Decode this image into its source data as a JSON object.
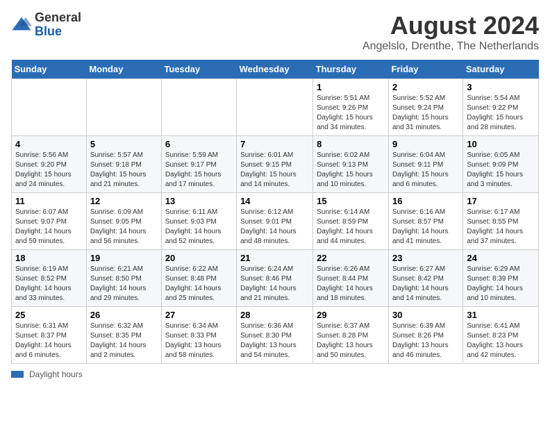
{
  "logo": {
    "general": "General",
    "blue": "Blue"
  },
  "header": {
    "month": "August 2024",
    "location": "Angelslo, Drenthe, The Netherlands"
  },
  "days_of_week": [
    "Sunday",
    "Monday",
    "Tuesday",
    "Wednesday",
    "Thursday",
    "Friday",
    "Saturday"
  ],
  "weeks": [
    [
      {
        "day": "",
        "info": ""
      },
      {
        "day": "",
        "info": ""
      },
      {
        "day": "",
        "info": ""
      },
      {
        "day": "",
        "info": ""
      },
      {
        "day": "1",
        "info": "Sunrise: 5:51 AM\nSunset: 9:26 PM\nDaylight: 15 hours and 34 minutes."
      },
      {
        "day": "2",
        "info": "Sunrise: 5:52 AM\nSunset: 9:24 PM\nDaylight: 15 hours and 31 minutes."
      },
      {
        "day": "3",
        "info": "Sunrise: 5:54 AM\nSunset: 9:22 PM\nDaylight: 15 hours and 28 minutes."
      }
    ],
    [
      {
        "day": "4",
        "info": "Sunrise: 5:56 AM\nSunset: 9:20 PM\nDaylight: 15 hours and 24 minutes."
      },
      {
        "day": "5",
        "info": "Sunrise: 5:57 AM\nSunset: 9:18 PM\nDaylight: 15 hours and 21 minutes."
      },
      {
        "day": "6",
        "info": "Sunrise: 5:59 AM\nSunset: 9:17 PM\nDaylight: 15 hours and 17 minutes."
      },
      {
        "day": "7",
        "info": "Sunrise: 6:01 AM\nSunset: 9:15 PM\nDaylight: 15 hours and 14 minutes."
      },
      {
        "day": "8",
        "info": "Sunrise: 6:02 AM\nSunset: 9:13 PM\nDaylight: 15 hours and 10 minutes."
      },
      {
        "day": "9",
        "info": "Sunrise: 6:04 AM\nSunset: 9:11 PM\nDaylight: 15 hours and 6 minutes."
      },
      {
        "day": "10",
        "info": "Sunrise: 6:05 AM\nSunset: 9:09 PM\nDaylight: 15 hours and 3 minutes."
      }
    ],
    [
      {
        "day": "11",
        "info": "Sunrise: 6:07 AM\nSunset: 9:07 PM\nDaylight: 14 hours and 59 minutes."
      },
      {
        "day": "12",
        "info": "Sunrise: 6:09 AM\nSunset: 9:05 PM\nDaylight: 14 hours and 56 minutes."
      },
      {
        "day": "13",
        "info": "Sunrise: 6:11 AM\nSunset: 9:03 PM\nDaylight: 14 hours and 52 minutes."
      },
      {
        "day": "14",
        "info": "Sunrise: 6:12 AM\nSunset: 9:01 PM\nDaylight: 14 hours and 48 minutes."
      },
      {
        "day": "15",
        "info": "Sunrise: 6:14 AM\nSunset: 8:59 PM\nDaylight: 14 hours and 44 minutes."
      },
      {
        "day": "16",
        "info": "Sunrise: 6:16 AM\nSunset: 8:57 PM\nDaylight: 14 hours and 41 minutes."
      },
      {
        "day": "17",
        "info": "Sunrise: 6:17 AM\nSunset: 8:55 PM\nDaylight: 14 hours and 37 minutes."
      }
    ],
    [
      {
        "day": "18",
        "info": "Sunrise: 6:19 AM\nSunset: 8:52 PM\nDaylight: 14 hours and 33 minutes."
      },
      {
        "day": "19",
        "info": "Sunrise: 6:21 AM\nSunset: 8:50 PM\nDaylight: 14 hours and 29 minutes."
      },
      {
        "day": "20",
        "info": "Sunrise: 6:22 AM\nSunset: 8:48 PM\nDaylight: 14 hours and 25 minutes."
      },
      {
        "day": "21",
        "info": "Sunrise: 6:24 AM\nSunset: 8:46 PM\nDaylight: 14 hours and 21 minutes."
      },
      {
        "day": "22",
        "info": "Sunrise: 6:26 AM\nSunset: 8:44 PM\nDaylight: 14 hours and 18 minutes."
      },
      {
        "day": "23",
        "info": "Sunrise: 6:27 AM\nSunset: 8:42 PM\nDaylight: 14 hours and 14 minutes."
      },
      {
        "day": "24",
        "info": "Sunrise: 6:29 AM\nSunset: 8:39 PM\nDaylight: 14 hours and 10 minutes."
      }
    ],
    [
      {
        "day": "25",
        "info": "Sunrise: 6:31 AM\nSunset: 8:37 PM\nDaylight: 14 hours and 6 minutes."
      },
      {
        "day": "26",
        "info": "Sunrise: 6:32 AM\nSunset: 8:35 PM\nDaylight: 14 hours and 2 minutes."
      },
      {
        "day": "27",
        "info": "Sunrise: 6:34 AM\nSunset: 8:33 PM\nDaylight: 13 hours and 58 minutes."
      },
      {
        "day": "28",
        "info": "Sunrise: 6:36 AM\nSunset: 8:30 PM\nDaylight: 13 hours and 54 minutes."
      },
      {
        "day": "29",
        "info": "Sunrise: 6:37 AM\nSunset: 8:28 PM\nDaylight: 13 hours and 50 minutes."
      },
      {
        "day": "30",
        "info": "Sunrise: 6:39 AM\nSunset: 8:26 PM\nDaylight: 13 hours and 46 minutes."
      },
      {
        "day": "31",
        "info": "Sunrise: 6:41 AM\nSunset: 8:23 PM\nDaylight: 13 hours and 42 minutes."
      }
    ]
  ],
  "legend": {
    "label": "Daylight hours"
  }
}
